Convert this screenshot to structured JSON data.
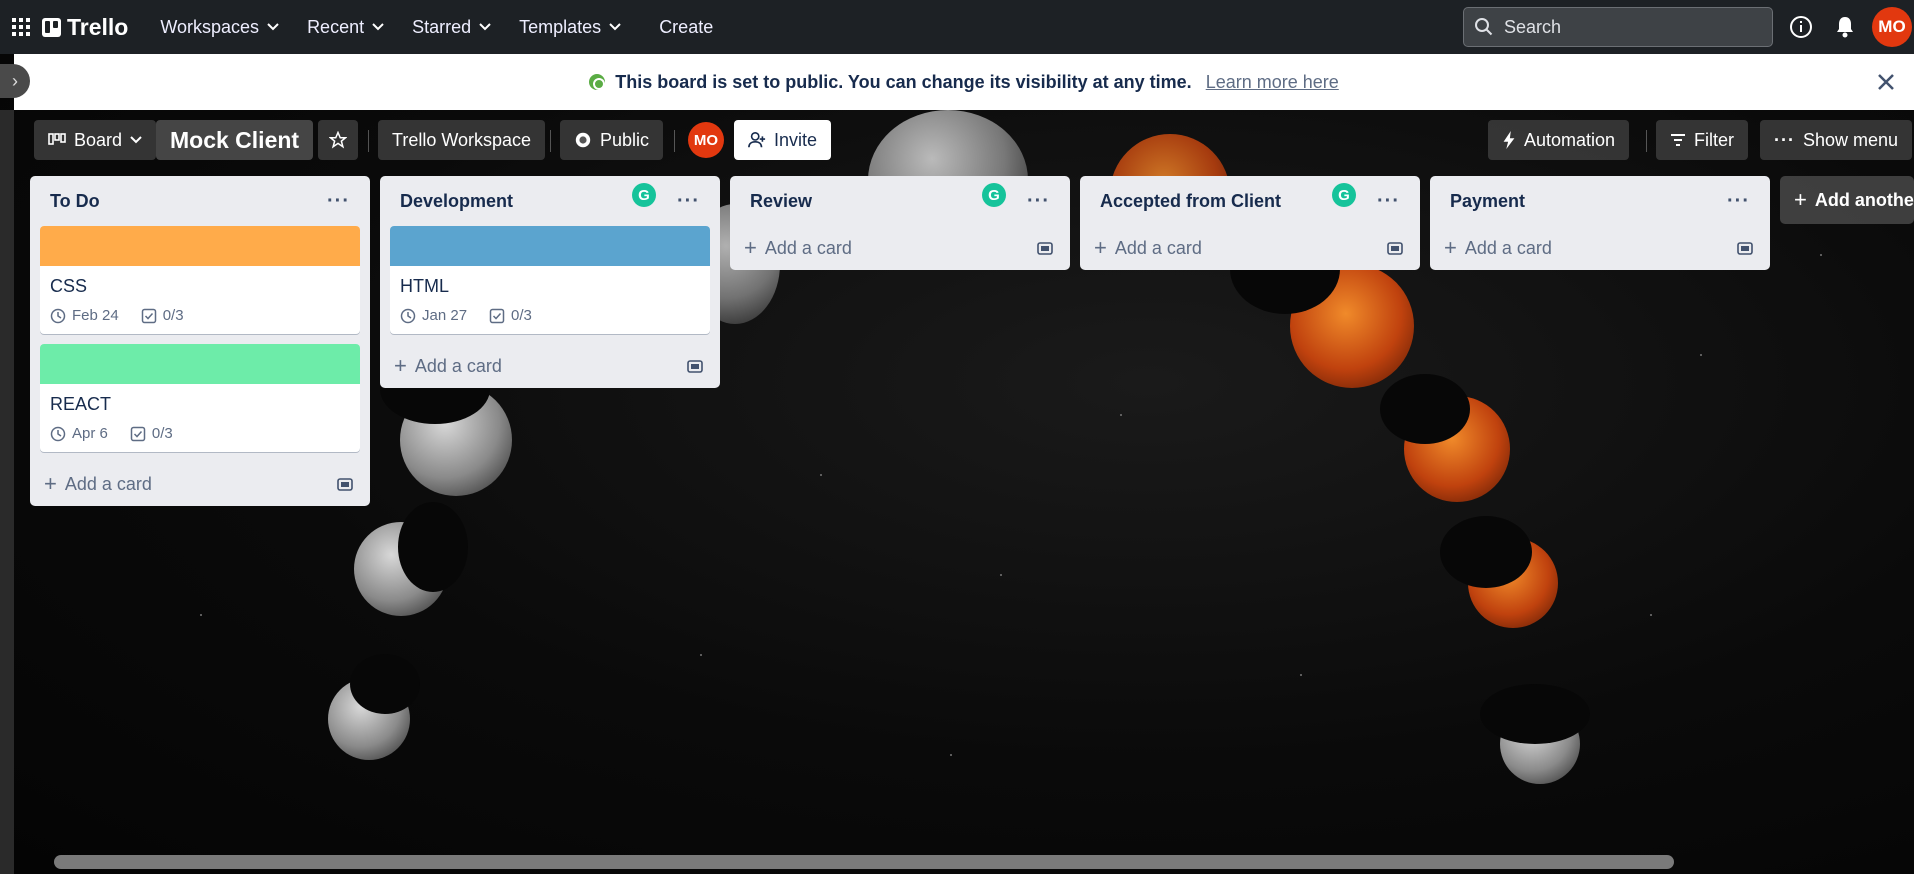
{
  "topbar": {
    "logo": "Trello",
    "nav": [
      {
        "label": "Workspaces"
      },
      {
        "label": "Recent"
      },
      {
        "label": "Starred"
      },
      {
        "label": "Templates"
      }
    ],
    "create_label": "Create",
    "search_placeholder": "Search",
    "avatar_initials": "MO"
  },
  "banner": {
    "message": "This board is set to public. You can change its visibility at any time.",
    "link": "Learn more here"
  },
  "board": {
    "view_label": "Board",
    "title": "Mock Client",
    "workspace": "Trello Workspace",
    "visibility": "Public",
    "member_initials": "MO",
    "invite_label": "Invite",
    "automation_label": "Automation",
    "filter_label": "Filter",
    "show_menu_label": "Show menu",
    "add_list_label": "Add another list"
  },
  "lists": [
    {
      "name": "To Do",
      "add_card": "Add a card",
      "cards": [
        {
          "title": "CSS",
          "cover": "#ffab4a",
          "due": "Feb 24",
          "checklist": "0/3"
        },
        {
          "title": "REACT",
          "cover": "#6deca9",
          "due": "Apr 6",
          "checklist": "0/3"
        }
      ]
    },
    {
      "name": "Development",
      "add_card": "Add a card",
      "cards": [
        {
          "title": "HTML",
          "cover": "#5ba4cf",
          "due": "Jan 27",
          "checklist": "0/3"
        }
      ]
    },
    {
      "name": "Review",
      "add_card": "Add a card",
      "cards": []
    },
    {
      "name": "Accepted from Client",
      "add_card": "Add a card",
      "cards": []
    },
    {
      "name": "Payment",
      "add_card": "Add a card",
      "cards": []
    }
  ],
  "colors": {
    "topbar": "#1d2125",
    "avatar": "#e2380f",
    "grammarly": "#15c39a",
    "banner_icon": "#5aac44"
  }
}
